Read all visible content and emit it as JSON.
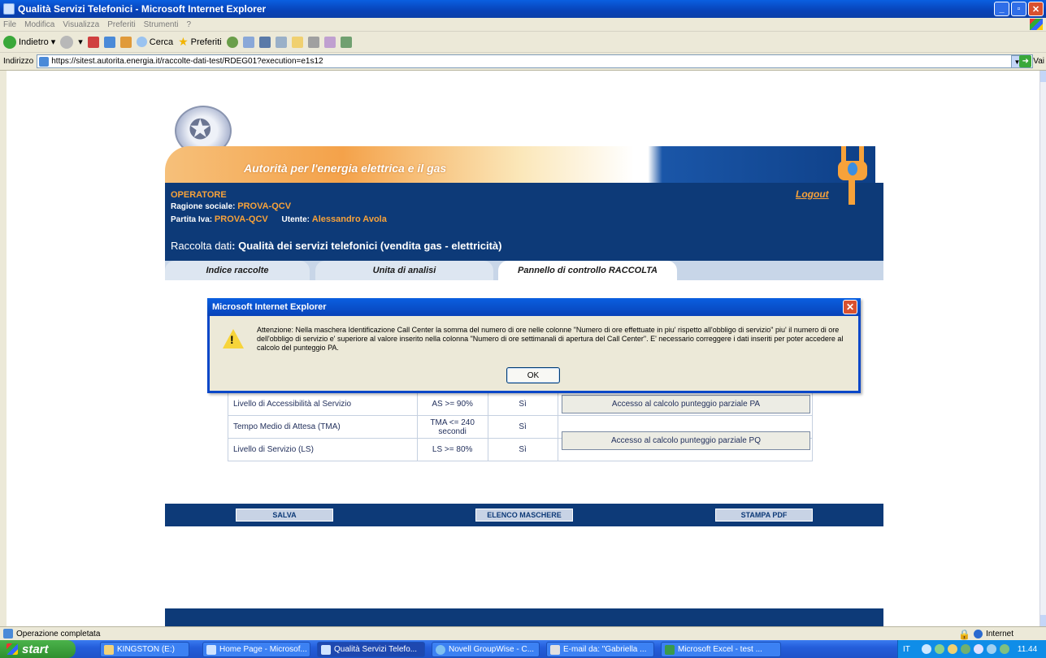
{
  "window": {
    "title": "Qualità Servizi Telefonici - Microsoft Internet Explorer"
  },
  "menu": [
    "File",
    "Modifica",
    "Visualizza",
    "Preferiti",
    "Strumenti",
    "?"
  ],
  "toolbar": {
    "back": "Indietro",
    "search": "Cerca",
    "favorites": "Preferiti"
  },
  "address": {
    "label": "Indirizzo",
    "url": "https://sitest.autorita.energia.it/raccolte-dati-test/RDEG01?execution=e1s12",
    "go": "Vai"
  },
  "header": {
    "banner": "Autorità per l'energia elettrica e il gas",
    "operator_title": "OPERATORE",
    "logout": "Logout",
    "ragione_label": "Ragione sociale:",
    "ragione_value": "PROVA-QCV",
    "piva_label": "Partita Iva:",
    "piva_value": "PROVA-QCV",
    "utente_label": "Utente:",
    "utente_value": "Alessandro Avola",
    "raccolta_label": "Raccolta dati",
    "raccolta_value": ": Qualità dei servizi telefonici (vendita gas - elettricità)"
  },
  "tabs": [
    "Indice raccolte",
    "Unita di analisi",
    "Pannello di controllo RACCOLTA"
  ],
  "table": {
    "rows": [
      {
        "name": "Livello di Accessibilità al Servizio",
        "threshold": "AS >= 90%",
        "ok": "Sì"
      },
      {
        "name": "Tempo Medio di Attesa (TMA)",
        "threshold": "TMA <= 240 secondi",
        "ok": "Sì"
      },
      {
        "name": "Livello di Servizio (LS)",
        "threshold": "LS >= 80%",
        "ok": "Sì"
      }
    ],
    "btn_pa": "Accesso al calcolo punteggio parziale PA",
    "btn_pq": "Accesso al calcolo punteggio parziale PQ"
  },
  "footer": {
    "salva": "SALVA",
    "elenco": "ELENCO MASCHERE",
    "stampa": "STAMPA PDF"
  },
  "dialog": {
    "title": "Microsoft Internet Explorer",
    "message": "Attenzione: Nella maschera Identificazione Call Center la somma del numero di ore nelle colonne \"Numero di ore effettuate in piu' rispetto all'obbligo di servizio\" piu' il numero di ore dell'obbligo di servizio e' superiore al valore inserito nella colonna \"Numero di ore settimanali di apertura del Call Center\". E' necessario correggere i dati inseriti per poter accedere al calcolo del punteggio PA.",
    "ok": "OK"
  },
  "status": {
    "text": "Operazione completata",
    "zone": "Internet"
  },
  "taskbar": {
    "start": "start",
    "tasks": [
      "KINGSTON (E:)",
      "Home Page - Microsof...",
      "Qualità Servizi Telefo...",
      "Novell GroupWise - C...",
      "E-mail da: \"Gabriella ...",
      "Microsoft Excel - test ..."
    ],
    "lang": "IT",
    "time": "11.44"
  }
}
